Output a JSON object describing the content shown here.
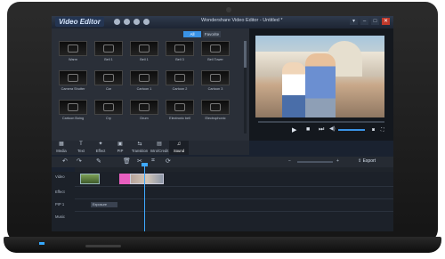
{
  "app": {
    "logo_text": "Video Editor",
    "title": "Wondershare Video Editor - Untitled *"
  },
  "window_controls": [
    "▾",
    "–",
    "□",
    "✕"
  ],
  "library": {
    "tabs": [
      {
        "label": "All",
        "active": true
      },
      {
        "label": "Favorite",
        "active": false
      }
    ],
    "items": [
      "Warm",
      "Bell 1",
      "Bell 1",
      "Bell 3",
      "Bell Tower",
      "Camera Shutter",
      "Car",
      "Cartoon 1",
      "Cartoon 2",
      "Cartoon 3",
      "Cartoon Boing",
      "Cry",
      "Drum",
      "Electronic bell",
      "Electrophonic"
    ]
  },
  "modes": [
    {
      "label": "Media",
      "icon": "▦",
      "active": false
    },
    {
      "label": "Text",
      "icon": "T",
      "active": false
    },
    {
      "label": "Effect",
      "icon": "✦",
      "active": false
    },
    {
      "label": "PIP",
      "icon": "▣",
      "active": false
    },
    {
      "label": "Transition",
      "icon": "⇆",
      "active": false
    },
    {
      "label": "Intro/Credit",
      "icon": "▤",
      "active": false
    },
    {
      "label": "Sound",
      "icon": "♫",
      "active": true
    }
  ],
  "toolbar": {
    "export_label": "Export"
  },
  "tracks": [
    {
      "label": "Video"
    },
    {
      "label": "Effect"
    },
    {
      "label": "PIP 1"
    },
    {
      "label": "Music"
    }
  ],
  "timeline": {
    "effect_clip_label": "Exposure"
  },
  "colors": {
    "accent": "#3a93e6",
    "playhead": "#3fa9ff",
    "pink_clip": "#e85fbf"
  }
}
